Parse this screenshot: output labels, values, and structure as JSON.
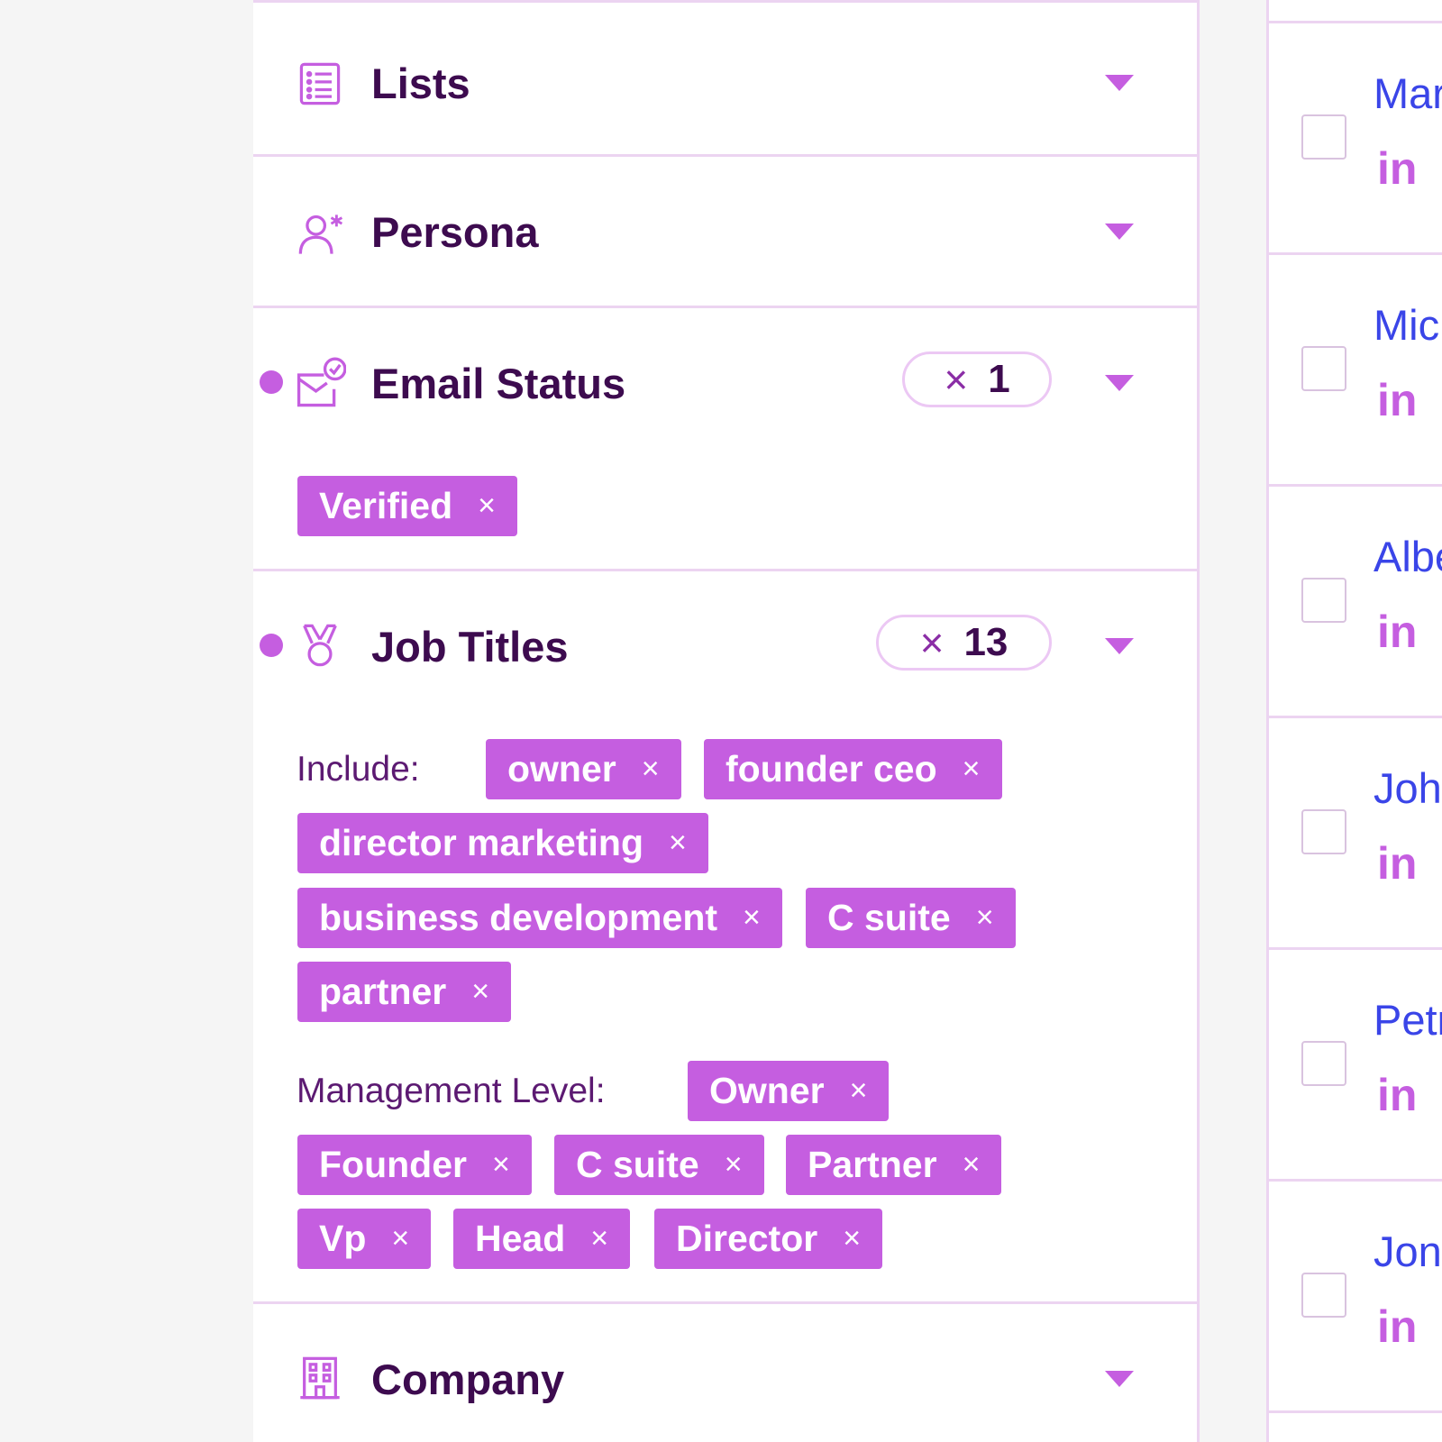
{
  "filters": {
    "lists": {
      "title": "Lists",
      "icon": "list-icon"
    },
    "persona": {
      "title": "Persona",
      "icon": "persona-icon"
    },
    "email_status": {
      "title": "Email Status",
      "icon": "email-check-icon",
      "clear_symbol": "×",
      "count": "1",
      "tags": [
        "Verified"
      ]
    },
    "job_titles": {
      "title": "Job Titles",
      "icon": "medal-icon",
      "clear_symbol": "×",
      "count": "13",
      "include_label": "Include:",
      "include_tags": [
        "owner",
        "founder ceo",
        "director marketing",
        "business development",
        "C suite",
        "partner"
      ],
      "management_label": "Management Level:",
      "management_tags": [
        "Owner",
        "Founder",
        "C suite",
        "Partner",
        "Vp",
        "Head",
        "Director"
      ]
    },
    "company": {
      "title": "Company",
      "icon": "building-icon"
    }
  },
  "tag_remove_symbol": "×",
  "results": {
    "rows": [
      {
        "name": "Mar",
        "link": "in"
      },
      {
        "name": "Mic",
        "link": "in"
      },
      {
        "name": "Albe",
        "link": "in"
      },
      {
        "name": "Joh",
        "link": "in"
      },
      {
        "name": "Petr",
        "link": "in"
      },
      {
        "name": "Jon",
        "link": "in"
      }
    ]
  },
  "colors": {
    "accent": "#c55ee0",
    "title": "#3d0b4f",
    "link": "#3a45e8",
    "divider": "#ecd4f1"
  }
}
